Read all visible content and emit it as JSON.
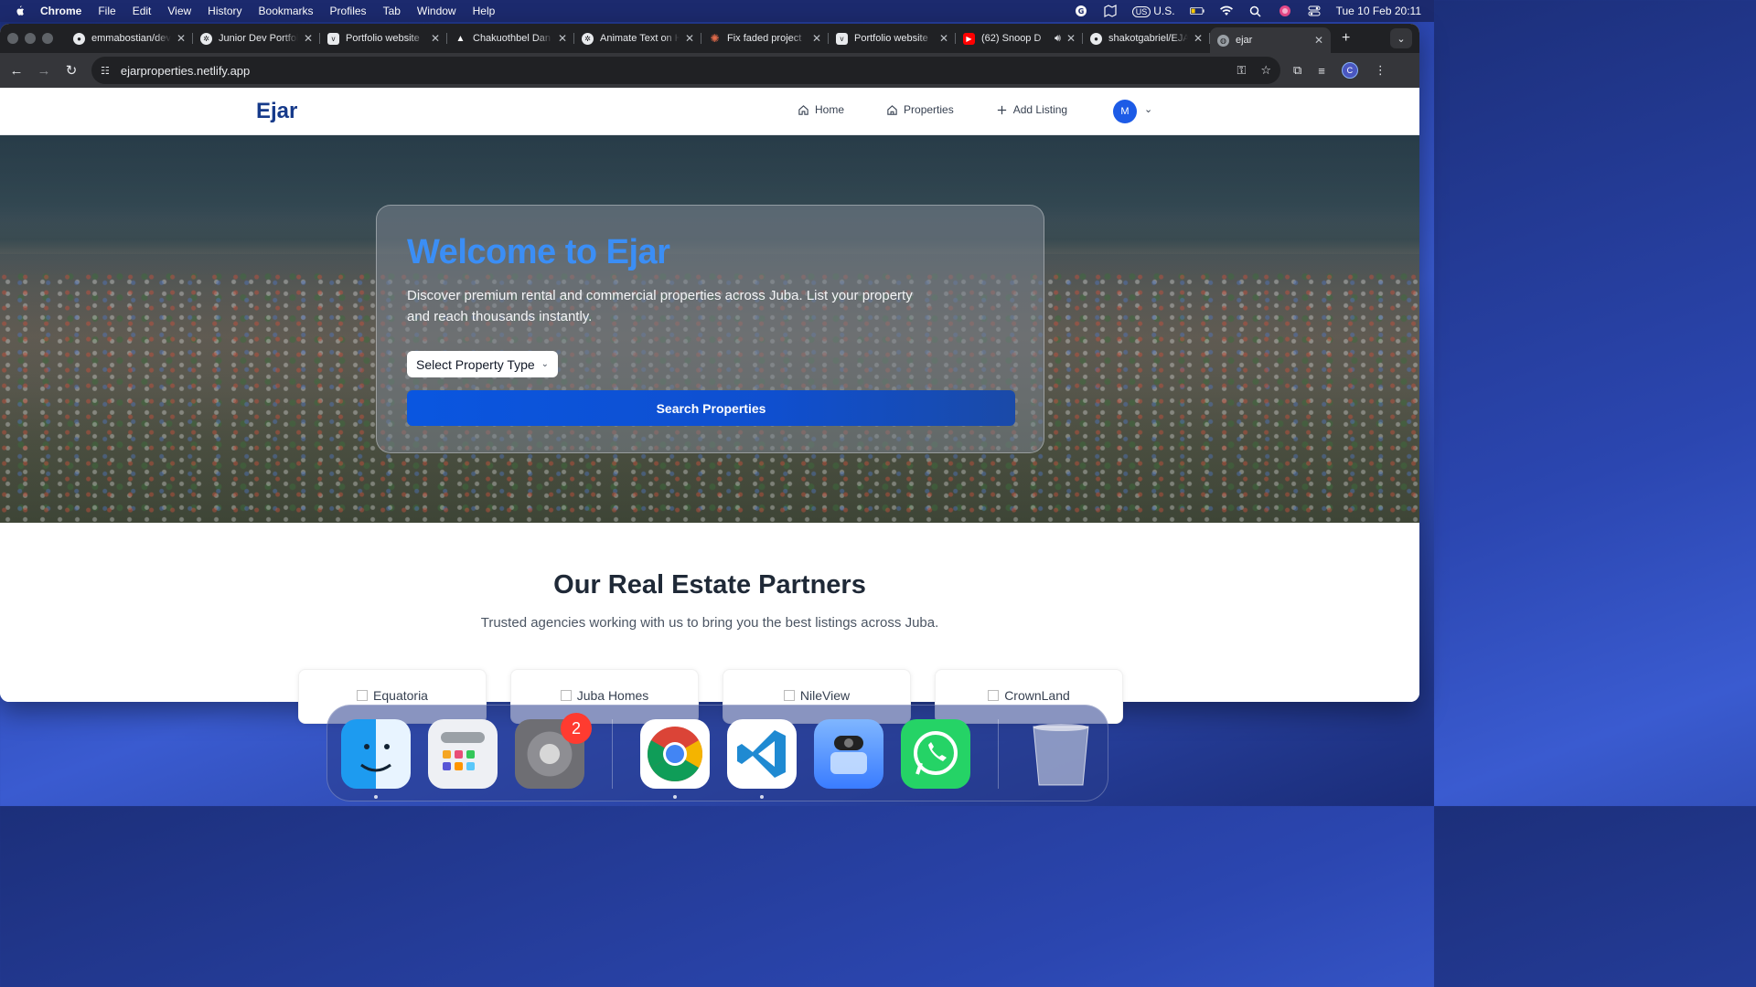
{
  "menubar": {
    "app": "Chrome",
    "items": [
      "File",
      "Edit",
      "View",
      "History",
      "Bookmarks",
      "Profiles",
      "Tab",
      "Window",
      "Help"
    ],
    "keyboard": "U.S.",
    "keyboard_badge": "US",
    "clock": "Tue 10 Feb  20:11"
  },
  "tabs": [
    {
      "label": "emmabostian/dev",
      "icon": "github-icon"
    },
    {
      "label": "Junior Dev Portfolio",
      "icon": "openai-icon"
    },
    {
      "label": "Portfolio website",
      "icon": "v0-icon"
    },
    {
      "label": "Chakuothbel Dan",
      "icon": "triangle-icon"
    },
    {
      "label": "Animate Text on H",
      "icon": "openai-icon"
    },
    {
      "label": "Fix faded project",
      "icon": "claude-icon"
    },
    {
      "label": "Portfolio website",
      "icon": "v0-icon"
    },
    {
      "label": "(62) Snoop D",
      "icon": "youtube-icon"
    },
    {
      "label": "shakotgabriel/EJA",
      "icon": "github-icon"
    },
    {
      "label": "ejar",
      "icon": "globe-icon",
      "active": true
    }
  ],
  "address": {
    "url": "ejarproperties.netlify.app"
  },
  "profile_initial": "C",
  "site": {
    "logo": "Ejar",
    "nav": {
      "home": "Home",
      "properties": "Properties",
      "add": "Add Listing"
    },
    "avatar": "M",
    "hero": {
      "title": "Welcome to Ejar",
      "subtitle": "Discover premium rental and commercial properties across Juba. List your property and reach thousands instantly.",
      "select_label": "Select Property Type",
      "button": "Search Properties"
    },
    "partners": {
      "title": "Our Real Estate Partners",
      "subtitle": "Trusted agencies working with us to bring you the best listings across Juba.",
      "cards": [
        "Equatoria",
        "Juba Homes",
        "NileView",
        "CrownLand"
      ]
    }
  },
  "dock": {
    "badge": "2",
    "apps": [
      "finder-icon",
      "launchpad-icon",
      "system-settings-icon",
      "chrome-icon",
      "vscode-icon",
      "preview-icon",
      "whatsapp-icon",
      "trash-icon"
    ]
  }
}
